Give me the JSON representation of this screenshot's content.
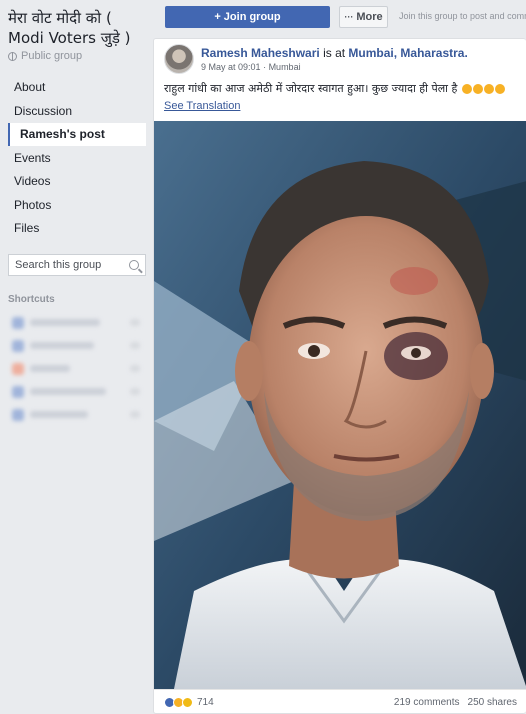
{
  "sidebar": {
    "group_title": "मेरा वोट मोदी को ( Modi Voters जुड़े )",
    "privacy": "Public group",
    "nav": [
      {
        "label": "About"
      },
      {
        "label": "Discussion"
      },
      {
        "label": "Ramesh's post",
        "active": true
      },
      {
        "label": "Events"
      },
      {
        "label": "Videos"
      },
      {
        "label": "Photos"
      },
      {
        "label": "Files"
      }
    ],
    "search_placeholder": "Search this group",
    "shortcuts_heading": "Shortcuts"
  },
  "topbar": {
    "join_label": "Join group",
    "join_icon": "plus-icon",
    "more_label": "More",
    "more_icon": "ellipsis-icon",
    "join_hint": "Join this group to post and comm"
  },
  "post": {
    "author": "Ramesh Maheshwari",
    "is_at": "is at",
    "location": "Mumbai, Maharastra.",
    "timestamp": "9 May at 09:01",
    "meta_location": "Mumbai",
    "text": "राहुल गांधी का आज अमेठी में जोरदार स्वागत हुआ। कुछ ज्यादा ही पेला है",
    "see_translation": "See Translation",
    "reaction_count": "714",
    "comments": "219 comments",
    "shares": "250 shares"
  },
  "colors": {
    "accent": "#4267b2",
    "link": "#385898",
    "page_bg": "#e9ebee"
  }
}
